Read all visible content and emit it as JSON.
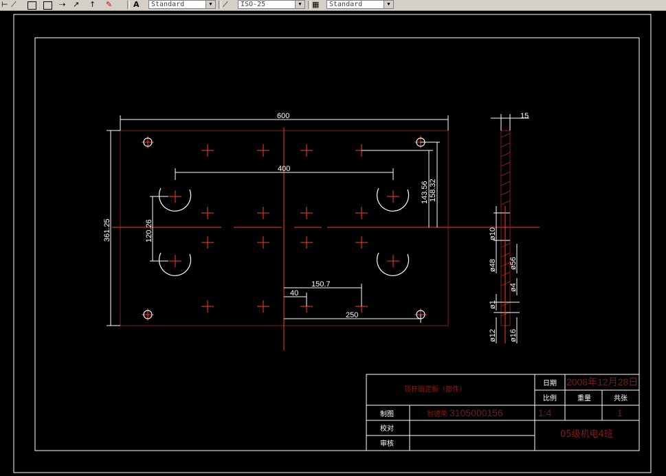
{
  "toolbar": {
    "text_style": "Standard",
    "dim_style": "ISO-25",
    "table_style": "Standard"
  },
  "dimensions": {
    "top_width": "600",
    "inner_width": "400",
    "height": "361.25",
    "hole_spacing_v": "120.26",
    "offset_a": "143.56",
    "offset_b": "158.32",
    "d_150": "150.7",
    "d_40": "40",
    "d_250": "250",
    "side_thk": "15",
    "dia_10": "ø10",
    "dia_48": "ø48",
    "dia_56": "ø56",
    "dia_4": "ø4",
    "dia_1": "ø1",
    "dia_12": "ø12",
    "dia_16": "ø16"
  },
  "title_block": {
    "part_name": "顶杆固定板（部件）",
    "date_label": "日期",
    "date_value": "2008年12月28日",
    "scale_label": "比例",
    "weight_label": "重量",
    "sheets_label": "共张",
    "drawn_label": "制图",
    "drawer": "翁德荣",
    "student_id": "3105000156",
    "scale_value": "1:4",
    "sheet_count": "1",
    "check_label": "校对",
    "review_label": "审核",
    "class_name": "05级机电4班"
  },
  "colors": {
    "background": "#000000",
    "lines": "#ffffff",
    "outline": "#8b1a1a",
    "crosshair": "#ff3b1f"
  }
}
